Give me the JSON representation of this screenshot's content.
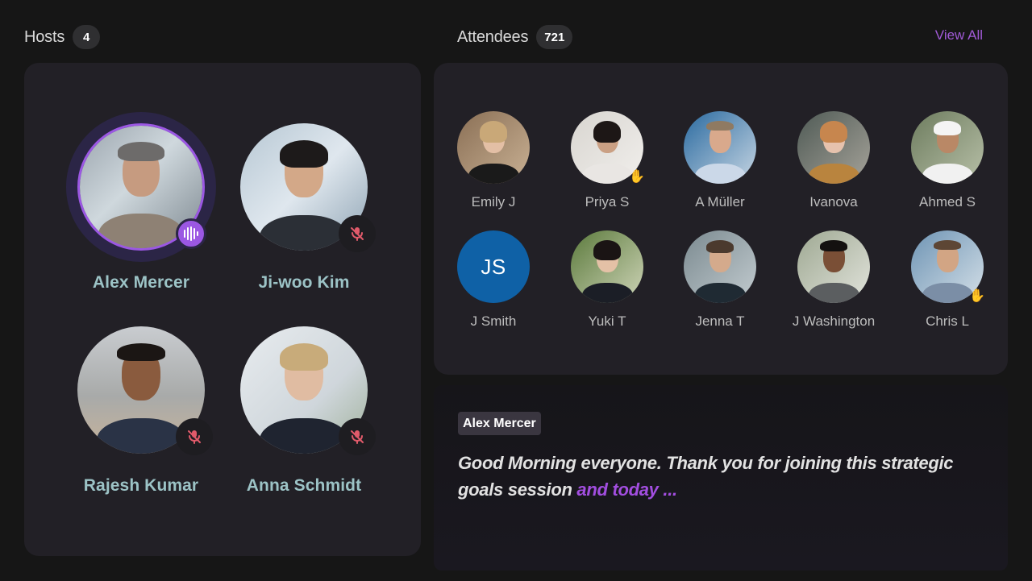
{
  "hosts": {
    "title": "Hosts",
    "count": "4",
    "items": [
      {
        "name": "Alex Mercer",
        "status": "speaking",
        "status_icon": "audio-waveform-icon"
      },
      {
        "name": "Ji-woo Kim",
        "status": "muted",
        "status_icon": "mic-off-icon"
      },
      {
        "name": "Rajesh Kumar",
        "status": "muted",
        "status_icon": "mic-off-icon"
      },
      {
        "name": "Anna Schmidt",
        "status": "muted",
        "status_icon": "mic-off-icon"
      }
    ]
  },
  "attendees": {
    "title": "Attendees",
    "count": "721",
    "view_all_label": "View All",
    "items": [
      {
        "name": "Emily J",
        "hand_raised": false
      },
      {
        "name": "Priya S",
        "hand_raised": true,
        "hand_icon": "✋"
      },
      {
        "name": "A Müller",
        "hand_raised": false
      },
      {
        "name": "Ivanova",
        "hand_raised": false
      },
      {
        "name": "Ahmed S",
        "hand_raised": false
      },
      {
        "name": "J Smith",
        "hand_raised": false,
        "initials": "JS"
      },
      {
        "name": "Yuki T",
        "hand_raised": false
      },
      {
        "name": "Jenna T",
        "hand_raised": false
      },
      {
        "name": "J Washington",
        "hand_raised": false
      },
      {
        "name": "Chris L",
        "hand_raised": true,
        "hand_icon": "✋"
      }
    ]
  },
  "caption": {
    "speaker": "Alex Mercer",
    "text": "Good Morning everyone. Thank you for joining this strategic goals session",
    "live_text": "and today ..."
  },
  "colors": {
    "accent": "#9b57e3",
    "host_name": "#9cc3c6",
    "muted_icon": "#e05a6a",
    "initials_avatar": "#0f61a6"
  }
}
